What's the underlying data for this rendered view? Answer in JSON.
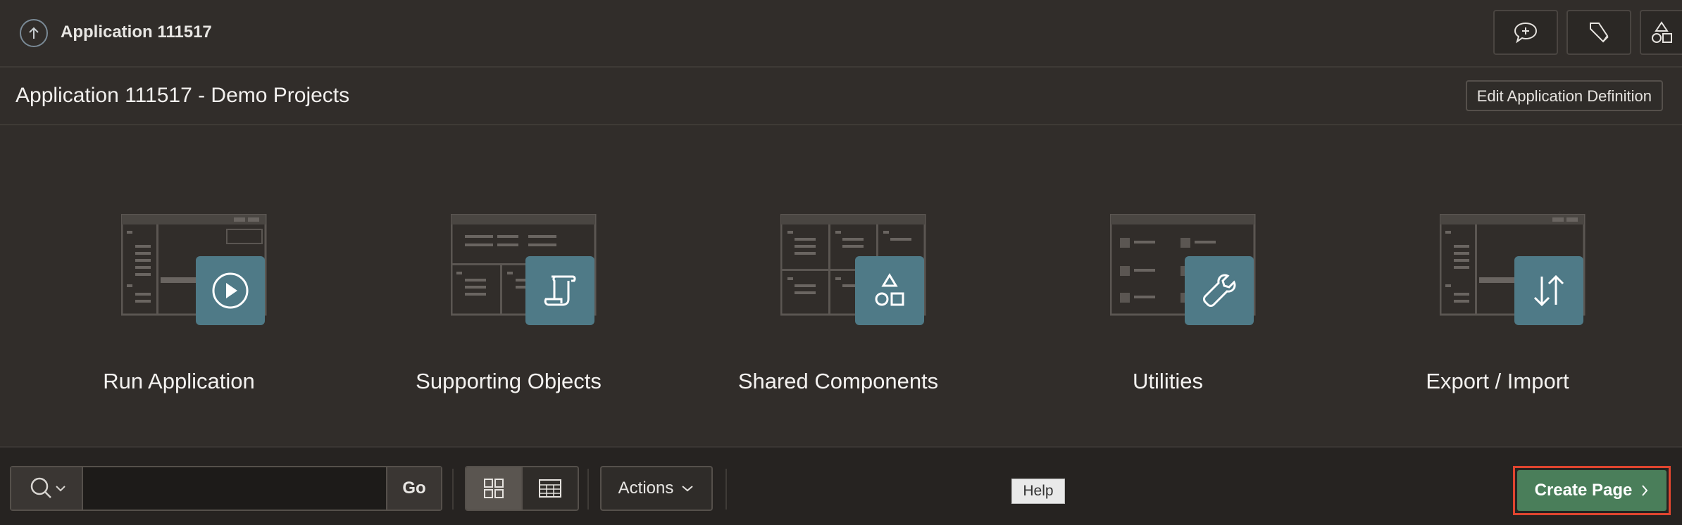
{
  "topbar": {
    "app_crumb": "Application 111517",
    "tools": [
      "feedback-icon",
      "developer-tools-icon",
      "shared-components-icon"
    ]
  },
  "header": {
    "title": "Application 111517 - Demo Projects",
    "edit_button": "Edit Application Definition"
  },
  "cards": [
    {
      "label": "Run Application",
      "icon": "play-icon"
    },
    {
      "label": "Supporting Objects",
      "icon": "scroll-icon"
    },
    {
      "label": "Shared Components",
      "icon": "shapes-icon"
    },
    {
      "label": "Utilities",
      "icon": "wrench-icon"
    },
    {
      "label": "Export / Import",
      "icon": "arrows-updown-icon"
    }
  ],
  "toolbar": {
    "search_placeholder": "",
    "go_label": "Go",
    "actions_label": "Actions",
    "help_tooltip": "Help",
    "create_page_label": "Create Page",
    "view_modes": [
      "icons-view",
      "report-view"
    ]
  },
  "colors": {
    "background": "#312d2a",
    "tile": "#4f7a87",
    "create_button": "#4a7e5a",
    "highlight_border": "#e0452f"
  }
}
